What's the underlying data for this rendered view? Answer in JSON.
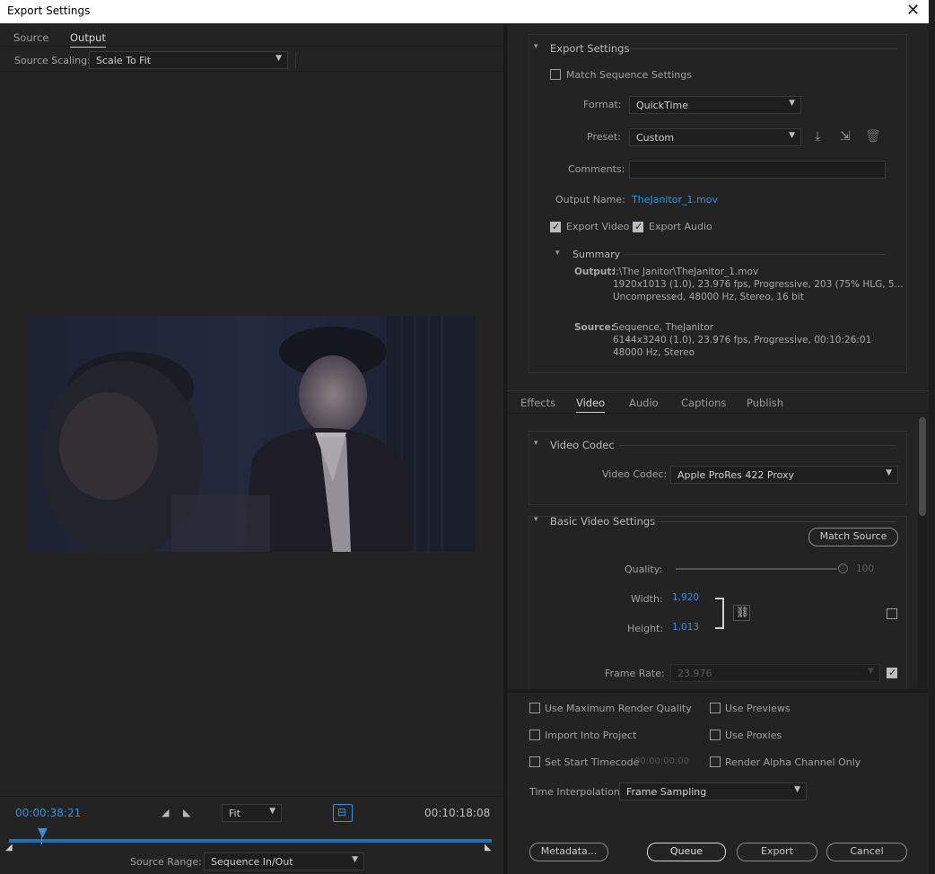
{
  "window": {
    "title": "Export Settings",
    "close_glyph": "✕"
  },
  "left": {
    "tabs": [
      "Source",
      "Output"
    ],
    "source_scaling_label": "Source Scaling:",
    "source_scaling_value": "Scale To Fit",
    "timecode_current": "00:00:38:21",
    "timecode_duration": "00:10:18:08",
    "zoom_value": "Fit",
    "source_range_label": "Source Range:",
    "source_range_value": "Sequence In/Out"
  },
  "export_settings": {
    "header": "Export Settings",
    "match_sequence_label": "Match Sequence Settings",
    "format_label": "Format:",
    "format_value": "QuickTime",
    "preset_label": "Preset:",
    "preset_value": "Custom",
    "comments_label": "Comments:",
    "output_name_label": "Output Name:",
    "output_name_value": "TheJanitor_1.mov",
    "export_video_label": "Export Video",
    "export_audio_label": "Export Audio",
    "summary_header": "Summary",
    "output_label": "Output:",
    "output_lines": [
      "I:\\The Janitor\\TheJanitor_1.mov",
      "1920x1013 (1.0), 23.976 fps, Progressive, 203 (75% HLG, 5...",
      "Uncompressed, 48000 Hz, Stereo, 16 bit"
    ],
    "source_label": "Source:",
    "source_lines": [
      "Sequence, TheJanitor",
      "6144x3240 (1.0), 23.976 fps, Progressive, 00:10:26:01",
      "48000 Hz, Stereo"
    ]
  },
  "tabs2": [
    "Effects",
    "Video",
    "Audio",
    "Captions",
    "Publish"
  ],
  "video_codec": {
    "header": "Video Codec",
    "label": "Video Codec:",
    "value": "Apple ProRes 422 Proxy"
  },
  "basic_video": {
    "header": "Basic Video Settings",
    "match_source": "Match Source",
    "quality_label": "Quality:",
    "quality_value": "100",
    "width_label": "Width:",
    "width_value": "1,920",
    "height_label": "Height:",
    "height_value": "1,013",
    "frame_rate_label": "Frame Rate:",
    "frame_rate_value": "23.976"
  },
  "options": {
    "max_render": "Use Maximum Render Quality",
    "use_previews": "Use Previews",
    "import_project": "Import Into Project",
    "use_proxies": "Use Proxies",
    "set_start_tc": "Set Start Timecode",
    "start_tc_value": "00:00:00:00",
    "render_alpha": "Render Alpha Channel Only",
    "time_interp_label": "Time Interpolation:",
    "time_interp_value": "Frame Sampling"
  },
  "buttons": {
    "metadata": "Metadata...",
    "queue": "Queue",
    "export": "Export",
    "cancel": "Cancel"
  }
}
